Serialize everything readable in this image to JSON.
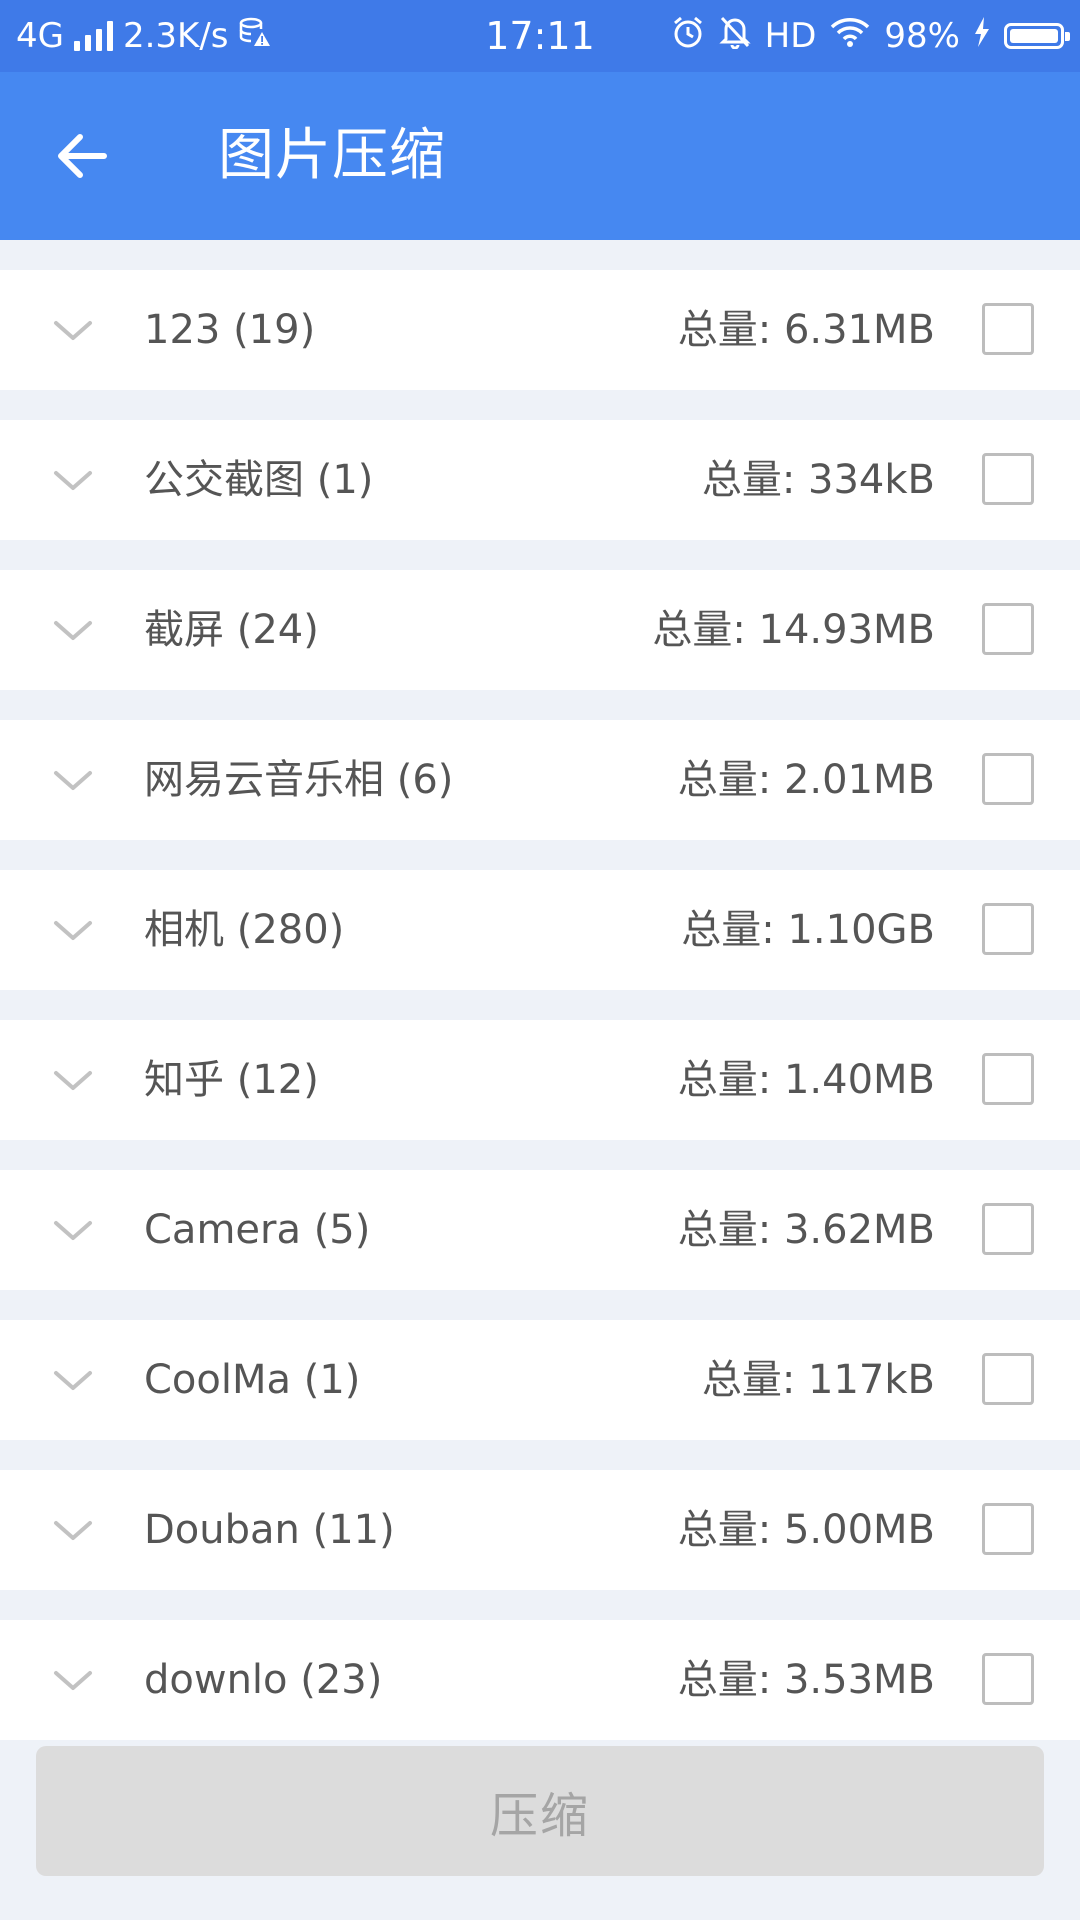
{
  "status_bar": {
    "network": "4G",
    "speed": "2.3K/s",
    "time": "17:11",
    "hd": "HD",
    "battery": "98%"
  },
  "app_bar": {
    "title": "图片压缩",
    "back_icon": "arrow-left-icon"
  },
  "colors": {
    "status_bar": "#3f7ae8",
    "app_bar": "#4688f1",
    "list_background": "#eef2f8",
    "button_disabled": "#dcdcdc"
  },
  "albums": [
    {
      "name": "123 (19)",
      "total": "总量: 6.31MB",
      "checked": false
    },
    {
      "name": "公交截图 (1)",
      "total": "总量: 334kB",
      "checked": false
    },
    {
      "name": "截屏 (24)",
      "total": "总量: 14.93MB",
      "checked": false
    },
    {
      "name": "网易云音乐相 (6)",
      "total": "总量: 2.01MB",
      "checked": false
    },
    {
      "name": "相机 (280)",
      "total": "总量: 1.10GB",
      "checked": false
    },
    {
      "name": "知乎 (12)",
      "total": "总量: 1.40MB",
      "checked": false
    },
    {
      "name": "Camera (5)",
      "total": "总量: 3.62MB",
      "checked": false
    },
    {
      "name": "CoolMa (1)",
      "total": "总量: 117kB",
      "checked": false
    },
    {
      "name": "Douban (11)",
      "total": "总量: 5.00MB",
      "checked": false
    },
    {
      "name": "downlo (23)",
      "total": "总量: 3.53MB",
      "checked": false
    }
  ],
  "actions": {
    "compress_label": "压缩",
    "compress_enabled": false
  }
}
